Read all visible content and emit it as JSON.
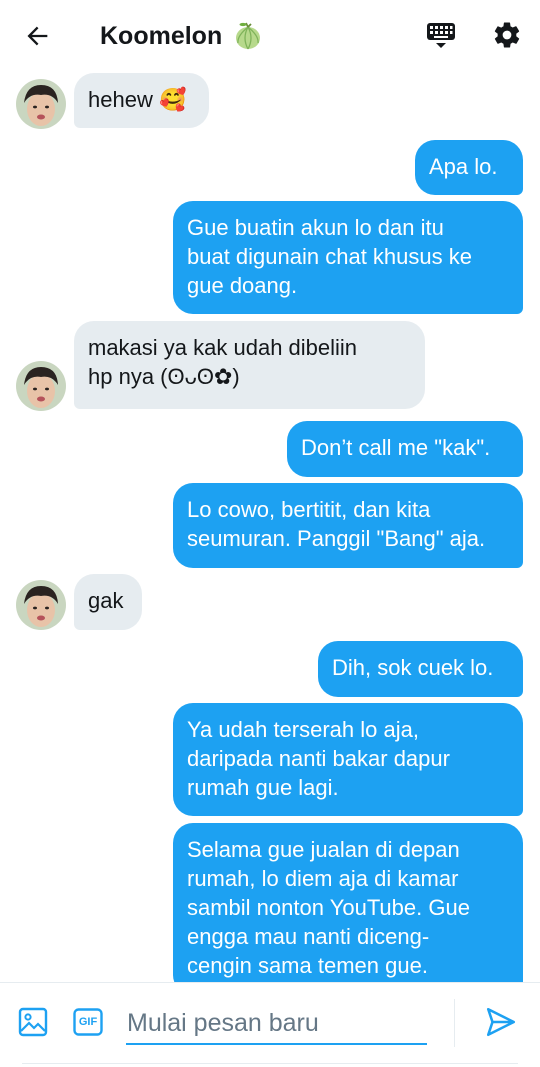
{
  "header": {
    "back_icon": "arrow-left-icon",
    "title": "Koomelon",
    "emoji": "melon",
    "keyboard_icon": "keyboard-icon",
    "settings_icon": "gear-icon"
  },
  "messages": [
    {
      "from": "them",
      "text": "hehew 🥰"
    },
    {
      "from": "me",
      "text": "Apa lo."
    },
    {
      "from": "me",
      "text": "Gue buatin akun lo dan itu\nbuat digunain chat khusus ke\ngue doang."
    },
    {
      "from": "them",
      "text": "makasi ya kak udah dibeliin\nhp nya (ʘᴗʘ✿)"
    },
    {
      "from": "me",
      "text": "Don’t call me \"kak\"."
    },
    {
      "from": "me",
      "text": "Lo cowo, bertitit, dan kita\nseumuran. Panggil \"Bang\" aja."
    },
    {
      "from": "them",
      "text": "gak"
    },
    {
      "from": "me",
      "text": "Dih, sok cuek lo."
    },
    {
      "from": "me",
      "text": "Ya udah terserah lo aja,\ndaripada nanti bakar dapur\nrumah gue lagi."
    },
    {
      "from": "me",
      "text": "Selama gue jualan di depan\nrumah, lo diem aja di kamar\nsambil nonton YouTube. Gue\nengga mau nanti diceng-\ncengin sama temen gue."
    }
  ],
  "composer": {
    "image_icon": "image-icon",
    "gif_label": "GIF",
    "placeholder": "Mulai pesan baru",
    "send_icon": "send-icon"
  },
  "colors": {
    "accent": "#1da1f2",
    "incoming_bubble": "#e6ecf0",
    "text": "#14171a",
    "placeholder": "#657786"
  }
}
